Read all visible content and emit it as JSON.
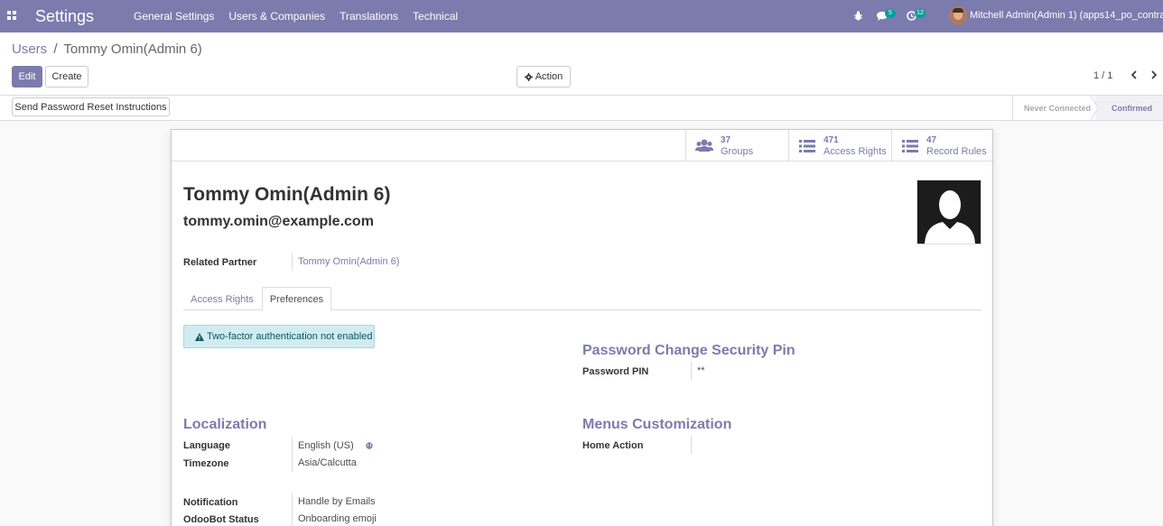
{
  "navbar": {
    "app_title": "Settings",
    "menu": [
      "General Settings",
      "Users & Companies",
      "Translations",
      "Technical"
    ],
    "messages_count": "5",
    "activities_count": "12",
    "user": "Mitchell Admin(Admin 1) (apps14_po_contract)"
  },
  "breadcrumb": {
    "parent": "Users",
    "separator": "/",
    "current": "Tommy Omin(Admin 6)"
  },
  "buttons": {
    "edit": "Edit",
    "create": "Create",
    "action": "Action"
  },
  "pager": "1 / 1",
  "statusbar": {
    "reset_button": "Send Password Reset Instructions",
    "states": [
      "Never Connected",
      "Confirmed"
    ],
    "active_state": "Confirmed"
  },
  "stat_buttons": [
    {
      "count": "37",
      "label": "Groups",
      "icon": "users-icon"
    },
    {
      "count": "471",
      "label": "Access Rights",
      "icon": "list-icon"
    },
    {
      "count": "47",
      "label": "Record Rules",
      "icon": "list-icon"
    }
  ],
  "user": {
    "name": "Tommy Omin(Admin 6)",
    "email": "tommy.omin@example.com",
    "related_partner_label": "Related Partner",
    "related_partner": "Tommy Omin(Admin 6)"
  },
  "tabs": [
    "Access Rights",
    "Preferences"
  ],
  "active_tab": "Preferences",
  "alert": "Two-factor authentication not enabled",
  "password_section": {
    "title": "Password Change Security Pin",
    "pin_label": "Password PIN",
    "pin_value": "**"
  },
  "localization": {
    "title": "Localization",
    "language_label": "Language",
    "language_value": "English (US)",
    "timezone_label": "Timezone",
    "timezone_value": "Asia/Calcutta"
  },
  "menus_customization": {
    "title": "Menus Customization",
    "home_action_label": "Home Action",
    "home_action_value": ""
  },
  "notification": {
    "label": "Notification",
    "value": "Handle by Emails"
  },
  "odoobot": {
    "label": "OdooBot Status",
    "value": "Onboarding emoji"
  },
  "colors": {
    "brand": "#7c7bad",
    "badge": "#00a09d",
    "alert_bg": "#d1ecf1"
  }
}
